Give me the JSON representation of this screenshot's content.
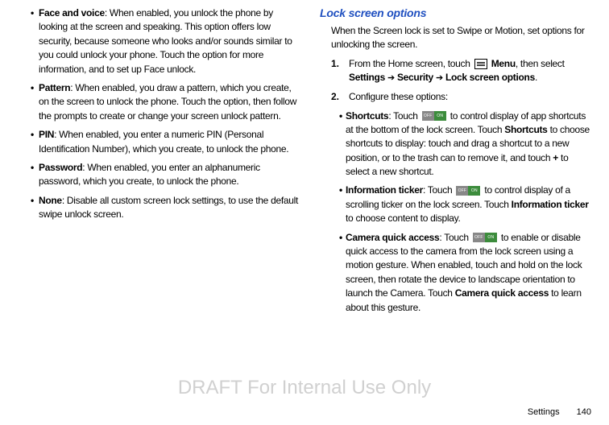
{
  "left": {
    "items": [
      {
        "title": "Face and voice",
        "body": ": When enabled, you unlock the phone by looking at the screen and speaking. This option offers low security, because someone who looks and/or sounds similar to you could unlock your phone. Touch the option for more information, and to set up Face unlock."
      },
      {
        "title": "Pattern",
        "body": ": When enabled, you draw a pattern, which you create, on the screen to unlock the phone. Touch the option, then follow the prompts to create or change your screen unlock pattern."
      },
      {
        "title": "PIN",
        "body": ": When enabled, you enter a numeric PIN (Personal Identification Number), which you create, to unlock the phone."
      },
      {
        "title": "Password",
        "body": ": When enabled, you enter an alphanumeric password, which you create, to unlock the phone."
      },
      {
        "title": "None",
        "body": ": Disable all custom screen lock settings, to use the default swipe unlock screen."
      }
    ]
  },
  "right": {
    "heading": "Lock screen options",
    "intro": "When the Screen lock is set to Swipe or Motion, set options for unlocking the screen.",
    "step1_a": "From the Home screen, touch ",
    "step1_menu": "Menu",
    "step1_b": ", then select ",
    "step1_path1": "Settings",
    "step1_arrow": "➔",
    "step1_path2": "Security",
    "step1_path3": "Lock screen options",
    "step2": "Configure these options:",
    "sub": [
      {
        "title": "Shortcuts",
        "pre": ": Touch ",
        "post": " to control display of app shortcuts at the bottom of the lock screen. Touch ",
        "bold2": "Shortcuts",
        "post2": " to choose shortcuts to display: touch and drag a shortcut to a new position, or to the trash can to remove it, and touch ",
        "bold3": "+",
        "post3": " to select a new shortcut."
      },
      {
        "title": "Information ticker",
        "pre": ": Touch ",
        "post": " to control display of a scrolling ticker on the lock screen. Touch ",
        "bold2": "Information ticker",
        "post2": " to choose content to display."
      },
      {
        "title": "Camera quick access",
        "pre": ": Touch ",
        "post": " to enable or disable quick access to the camera from the lock screen using a motion gesture. When enabled, touch and hold on the lock screen, then rotate the device to landscape orientation to launch the Camera. Touch ",
        "bold2": "Camera quick access",
        "post2": " to learn about this gesture."
      }
    ]
  },
  "toggle": {
    "off": "OFF",
    "on": "ON"
  },
  "watermark": "DRAFT For Internal Use Only",
  "footer": {
    "section": "Settings",
    "page": "140"
  }
}
